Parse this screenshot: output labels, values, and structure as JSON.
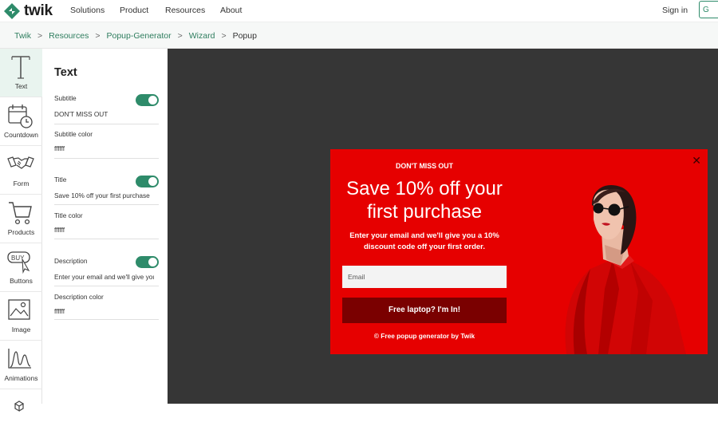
{
  "brand": {
    "name": "twik",
    "accent": "#2e8b6a"
  },
  "nav": {
    "links": [
      "Solutions",
      "Product",
      "Resources",
      "About"
    ],
    "signin": "Sign in",
    "cta": "G"
  },
  "breadcrumb": {
    "items": [
      "Twik",
      "Resources",
      "Popup-Generator",
      "Wizard"
    ],
    "current": "Popup",
    "separator": ">"
  },
  "rail": {
    "items": [
      {
        "label": "Text",
        "icon": "text-icon"
      },
      {
        "label": "Countdown",
        "icon": "countdown-icon"
      },
      {
        "label": "Form",
        "icon": "handshake-icon"
      },
      {
        "label": "Products",
        "icon": "cart-icon"
      },
      {
        "label": "Buttons",
        "icon": "buy-button-icon"
      },
      {
        "label": "Image",
        "icon": "image-icon"
      },
      {
        "label": "Animations",
        "icon": "animation-icon"
      }
    ]
  },
  "panel": {
    "title": "Text",
    "subtitle_label": "Subtitle",
    "subtitle_value": "DON'T MISS OUT",
    "subtitle_color_label": "Subtitle color",
    "subtitle_color_value": "ffffff",
    "title_label": "Title",
    "title_value": "Save 10% off your first purchase",
    "title_color_label": "Title color",
    "title_color_value": "ffffff",
    "description_label": "Description",
    "description_value": "Enter your email and we'll give you a 10% discount code off your first order.",
    "description_color_label": "Description color",
    "description_color_value": "ffffff"
  },
  "popup": {
    "background": "#e60000",
    "subtitle": "DON'T MISS OUT",
    "title": "Save 10% off your first purchase",
    "description": "Enter your email and we'll give you a 10% discount code off your first order.",
    "email_placeholder": "Email",
    "button": "Free laptop? I'm In!",
    "footer": "© Free popup generator by Twik",
    "close": "✕"
  }
}
